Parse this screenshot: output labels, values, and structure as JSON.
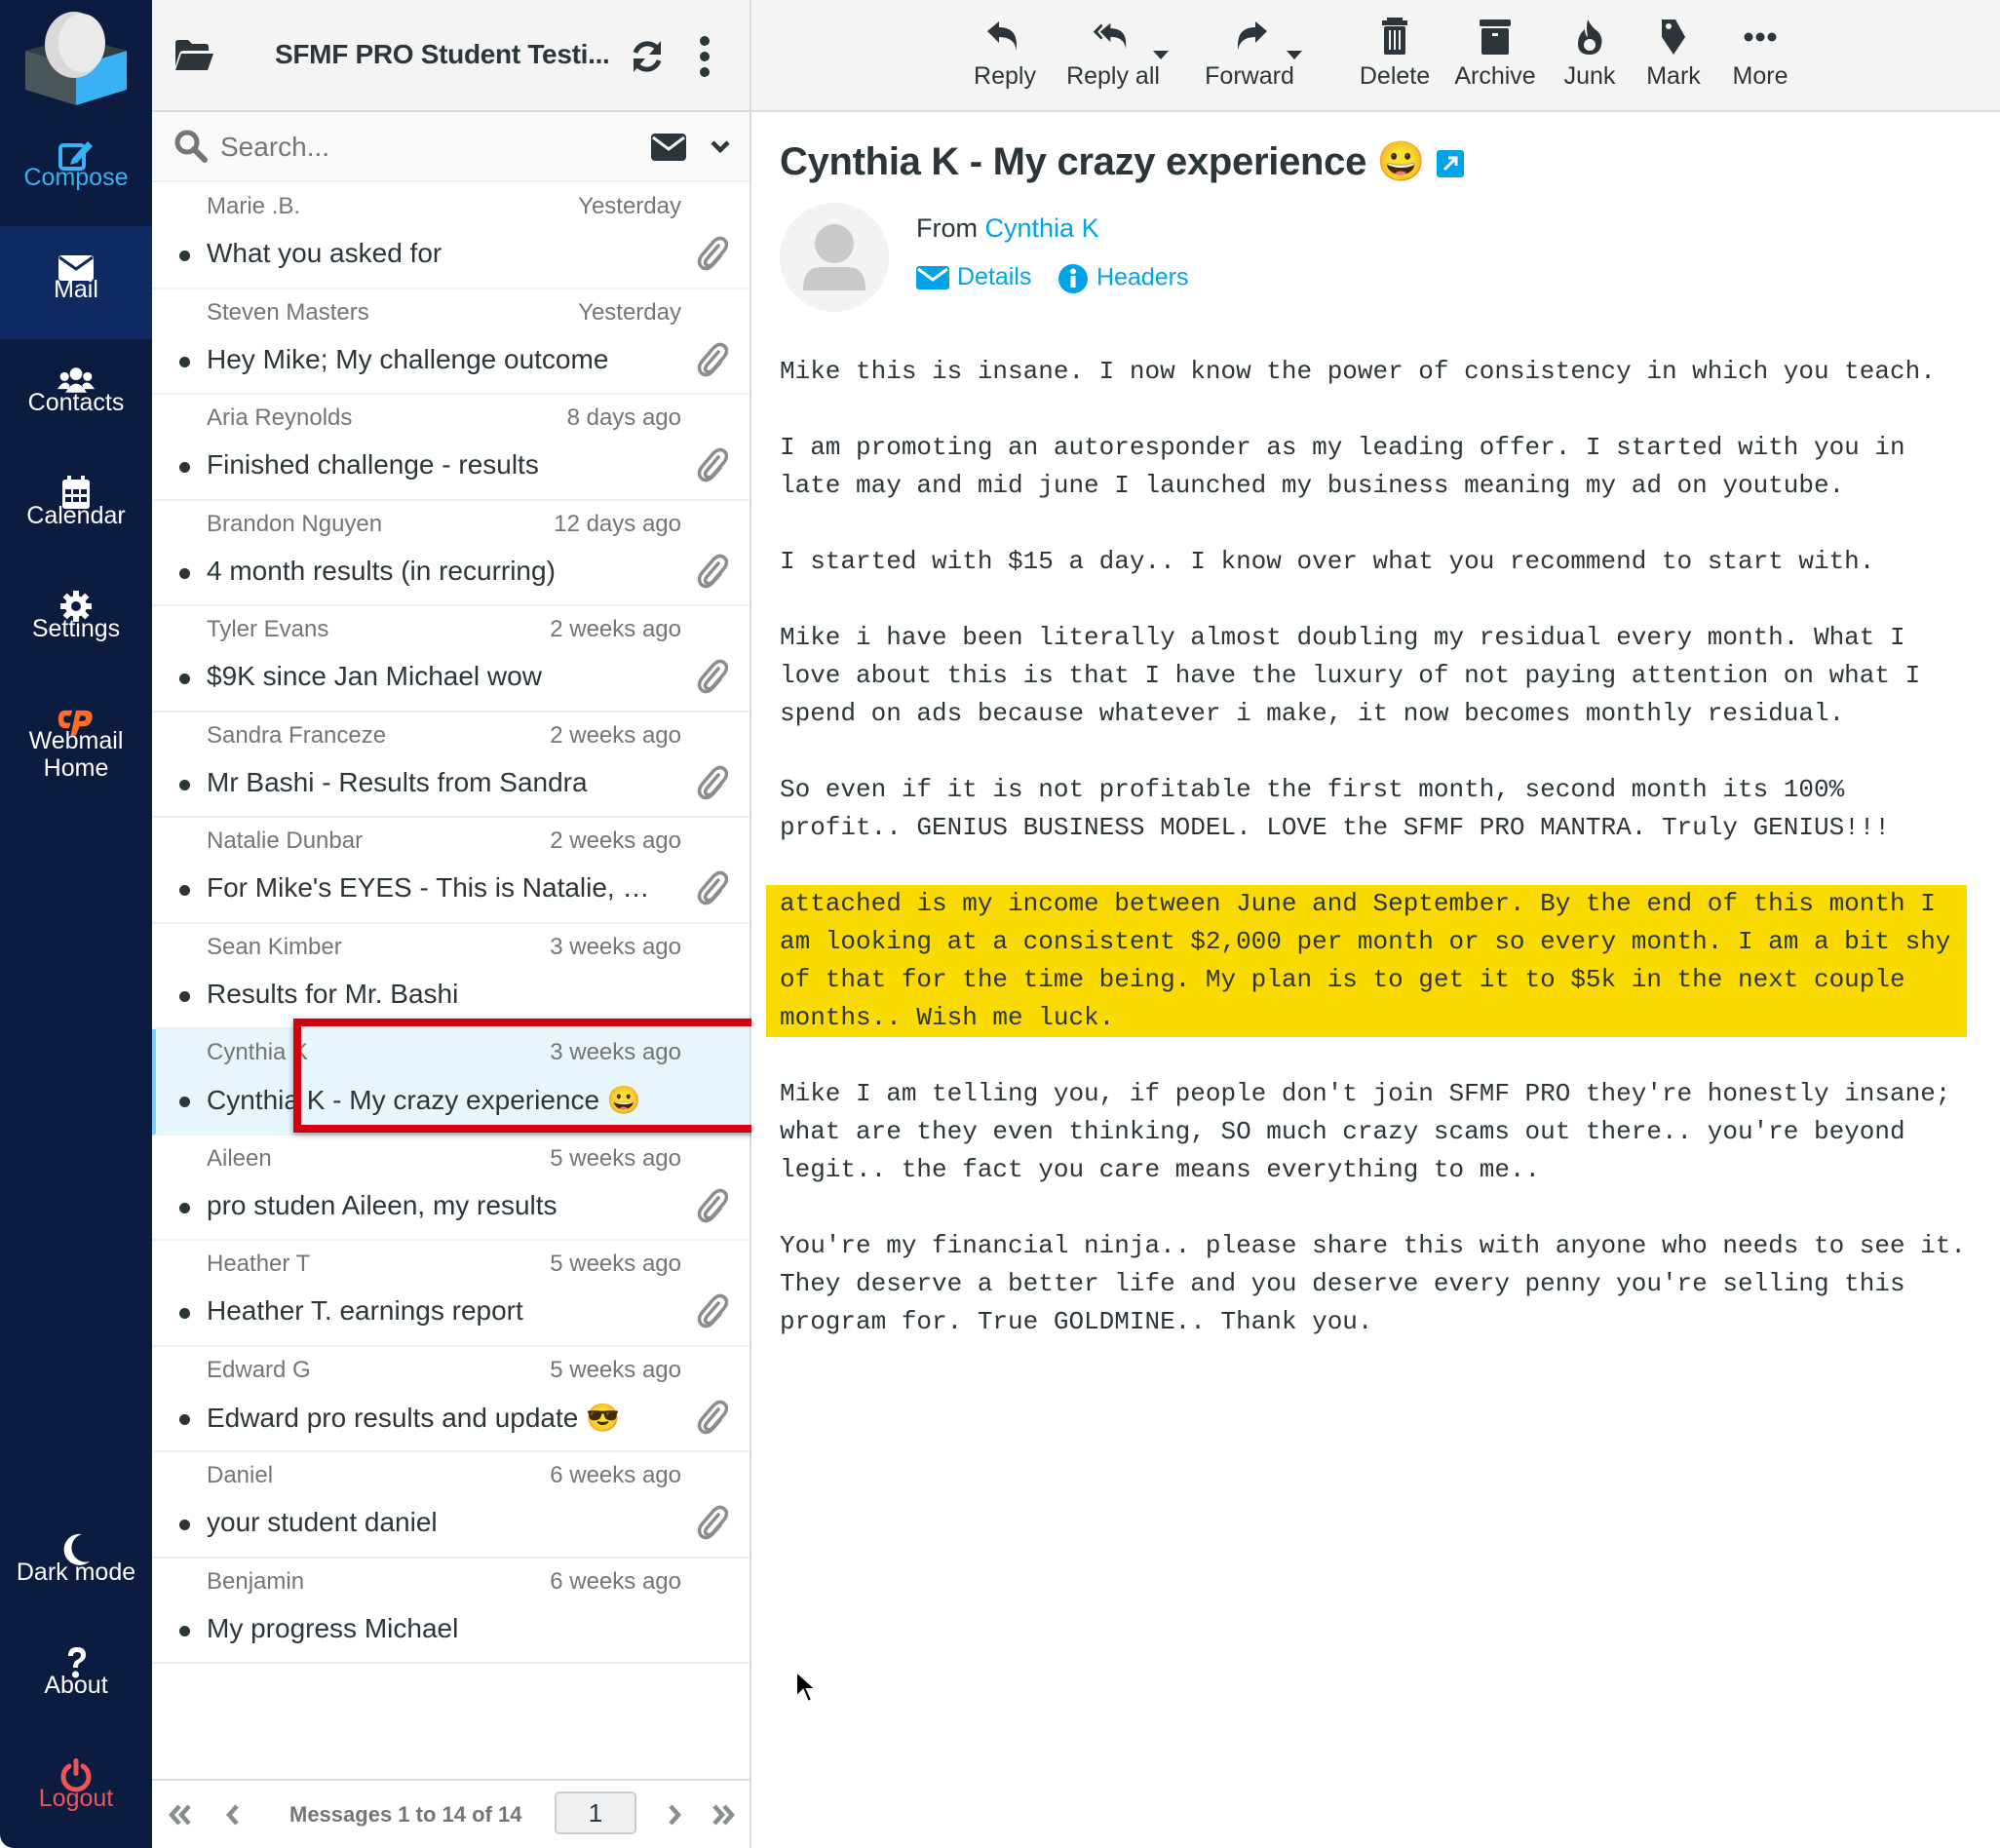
{
  "sidebar": {
    "items": [
      {
        "label": "Compose",
        "icon": "compose-icon"
      },
      {
        "label": "Mail",
        "icon": "mail-icon",
        "selected": true
      },
      {
        "label": "Contacts",
        "icon": "contacts-icon"
      },
      {
        "label": "Calendar",
        "icon": "calendar-icon"
      },
      {
        "label": "Settings",
        "icon": "gear-icon"
      },
      {
        "label": "Webmail\nHome",
        "icon": "cpanel-icon"
      },
      {
        "label": "Dark mode",
        "icon": "moon-icon"
      },
      {
        "label": "About",
        "icon": "question-icon"
      },
      {
        "label": "Logout",
        "icon": "power-icon"
      }
    ]
  },
  "list": {
    "folder_title": "SFMF PRO Student Testi...",
    "search_placeholder": "Search...",
    "messages": [
      {
        "from": "Marie .B.",
        "date": "Yesterday",
        "subject": "What you asked for",
        "attachment": true
      },
      {
        "from": "Steven Masters",
        "date": "Yesterday",
        "subject": "Hey Mike; My challenge outcome",
        "attachment": true
      },
      {
        "from": "Aria Reynolds",
        "date": "8 days ago",
        "subject": "Finished challenge - results",
        "attachment": true
      },
      {
        "from": "Brandon Nguyen",
        "date": "12 days ago",
        "subject": "4 month results (in recurring)",
        "attachment": true
      },
      {
        "from": "Tyler Evans",
        "date": "2 weeks ago",
        "subject": "$9K since Jan Michael wow",
        "attachment": true
      },
      {
        "from": "Sandra Franceze",
        "date": "2 weeks ago",
        "subject": "Mr Bashi - Results from Sandra",
        "attachment": true
      },
      {
        "from": "Natalie Dunbar",
        "date": "2 weeks ago",
        "subject": "For Mike's EYES - This is Natalie, My results",
        "attachment": true
      },
      {
        "from": "Sean Kimber",
        "date": "3 weeks ago",
        "subject": "Results for Mr. Bashi",
        "attachment": false
      },
      {
        "from": "Cynthia K",
        "date": "3 weeks ago",
        "subject": "Cynthia K - My crazy experience 😀",
        "attachment": false,
        "selected": true
      },
      {
        "from": "Aileen",
        "date": "5 weeks ago",
        "subject": "pro studen Aileen, my results",
        "attachment": true
      },
      {
        "from": "Heather T",
        "date": "5 weeks ago",
        "subject": "Heather T. earnings report",
        "attachment": true
      },
      {
        "from": "Edward G",
        "date": "5 weeks ago",
        "subject": "Edward pro results and update 😎",
        "attachment": true
      },
      {
        "from": "Daniel",
        "date": "6 weeks ago",
        "subject": "your student daniel",
        "attachment": true
      },
      {
        "from": "Benjamin",
        "date": "6 weeks ago",
        "subject": "My progress Michael",
        "attachment": false
      }
    ],
    "pager": {
      "count_text": "Messages 1 to 14 of 14",
      "page": "1"
    }
  },
  "toolbar": {
    "reply": "Reply",
    "reply_all": "Reply all",
    "forward": "Forward",
    "delete": "Delete",
    "archive": "Archive",
    "junk": "Junk",
    "mark": "Mark",
    "more": "More"
  },
  "message": {
    "subject": "Cynthia K - My crazy experience 😀",
    "from_label": "From",
    "from_name": "Cynthia K",
    "details_label": "Details",
    "headers_label": "Headers",
    "paragraphs": [
      "Mike this is insane. I now know the power of consistency in which you teach.",
      "I am promoting an autoresponder as my leading offer. I started with you in\nlate may and mid june I launched my business meaning my ad on youtube.",
      "I started with $15 a day.. I know over what you recommend to start with.",
      "Mike i have been literally almost doubling my residual every month. What I\nlove about this is that I have the luxury of not paying attention on what I\nspend on ads because whatever i make, it now becomes monthly residual.",
      "So even if it is not profitable the first month, second month its 100%\nprofit.. GENIUS BUSINESS MODEL. LOVE the SFMF PRO MANTRA. Truly GENIUS!!!",
      "attached is my income between June and September. By the end of this month I\nam looking at a consistent $2,000 per month or so every month. I am a bit shy\nof that for the time being. My plan is to get it to $5k in the next couple\nmonths.. Wish me luck.",
      "Mike I am telling you, if people don't join SFMF PRO they're honestly insane;\nwhat are they even thinking, SO much crazy scams out there.. you're beyond\nlegit.. the fact you care means everything to me..",
      "You're my financial ninja.. please share this with anyone who needs to see it.\nThey deserve a better life and you deserve every penny you're selling this\nprogram for. True GOLDMINE.. Thank you."
    ],
    "highlighted_paragraph_index": 5
  },
  "colors": {
    "sidebar_bg": "#0b1c40",
    "sidebar_selected": "#0f2a62",
    "accent": "#00a3e8",
    "compose": "#37b2f5",
    "logout": "#ee5555",
    "highlight": "#fbda00",
    "selection_box": "#d30012"
  }
}
